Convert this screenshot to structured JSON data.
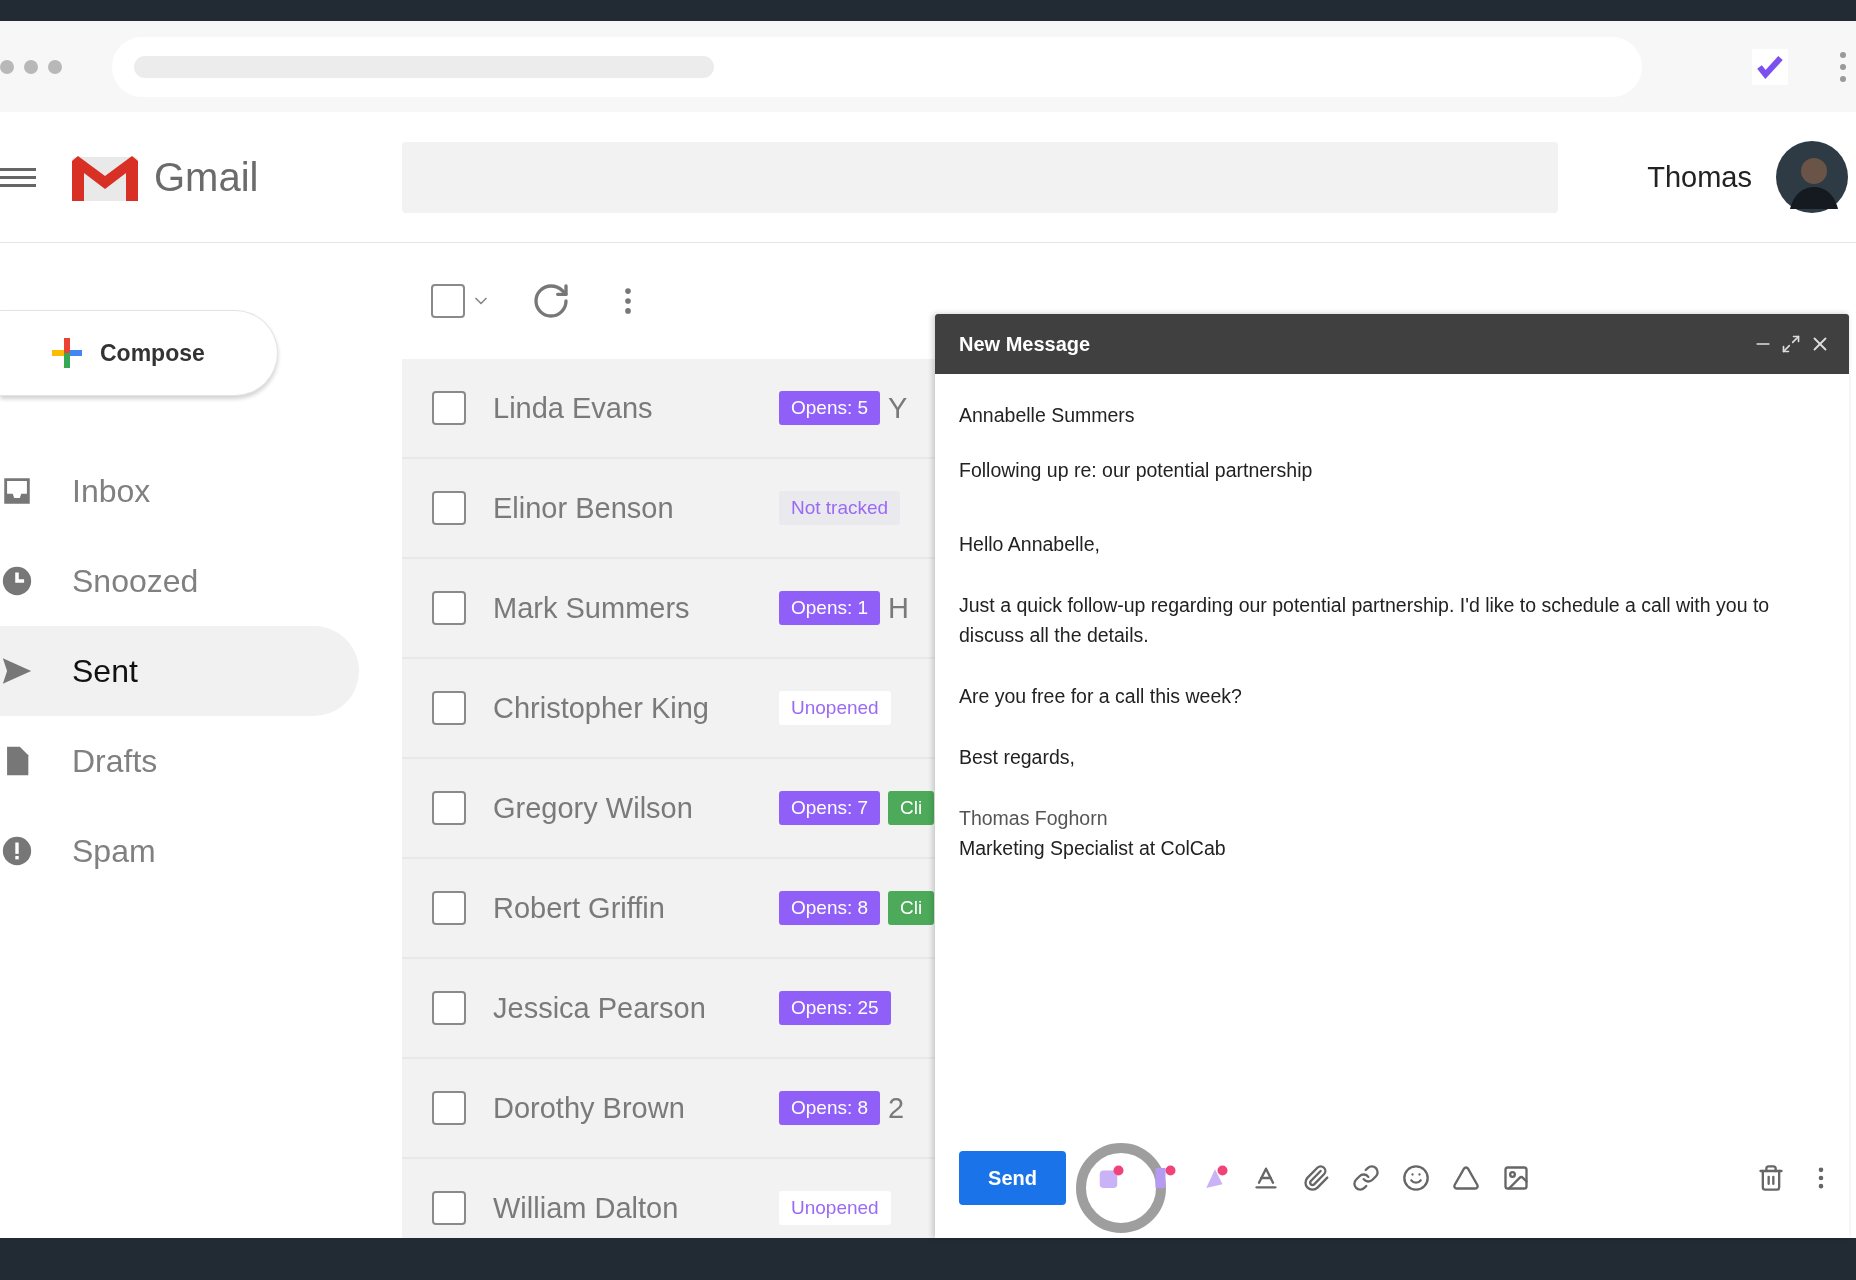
{
  "header": {
    "app_name": "Gmail",
    "user_name": "Thomas"
  },
  "compose_button": {
    "label": "Compose"
  },
  "nav": [
    {
      "label": "Inbox",
      "selected": false
    },
    {
      "label": "Snoozed",
      "selected": false
    },
    {
      "label": "Sent",
      "selected": true
    },
    {
      "label": "Drafts",
      "selected": false
    },
    {
      "label": "Spam",
      "selected": false
    }
  ],
  "toolbar": {
    "select_all_checked": false
  },
  "messages": [
    {
      "sender": "Linda Evans",
      "checked": false,
      "badges": [
        {
          "kind": "opens",
          "text": "Opens: 5"
        }
      ],
      "snippet": "Y"
    },
    {
      "sender": "Elinor Benson",
      "checked": false,
      "badges": [
        {
          "kind": "not_tracked",
          "text": "Not tracked"
        }
      ]
    },
    {
      "sender": "Mark Summers",
      "checked": false,
      "badges": [
        {
          "kind": "opens",
          "text": "Opens: 1"
        }
      ],
      "snippet": "H"
    },
    {
      "sender": "Christopher King",
      "checked": false,
      "badges": [
        {
          "kind": "unopened",
          "text": "Unopened"
        }
      ]
    },
    {
      "sender": "Gregory Wilson",
      "checked": false,
      "badges": [
        {
          "kind": "opens",
          "text": "Opens: 7"
        },
        {
          "kind": "clicks",
          "text": "Cli"
        }
      ]
    },
    {
      "sender": "Robert Griffin",
      "checked": false,
      "badges": [
        {
          "kind": "opens",
          "text": "Opens: 8"
        },
        {
          "kind": "clicks",
          "text": "Cli"
        }
      ]
    },
    {
      "sender": "Jessica Pearson",
      "checked": false,
      "badges": [
        {
          "kind": "opens",
          "text": "Opens: 25"
        }
      ]
    },
    {
      "sender": "Dorothy Brown",
      "checked": false,
      "badges": [
        {
          "kind": "opens",
          "text": "Opens: 8"
        }
      ],
      "snippet": "2"
    },
    {
      "sender": "William Dalton",
      "checked": false,
      "badges": [
        {
          "kind": "unopened",
          "text": "Unopened"
        }
      ]
    }
  ],
  "compose": {
    "title": "New Message",
    "to": "Annabelle Summers",
    "subject": "Following up re: our potential partnership",
    "paragraphs": [
      [
        "Hello Annabelle,"
      ],
      [
        "Just a quick follow-up regarding our potential partnership. I'd like to schedule a call with you to discuss all the details."
      ],
      [
        "Are you free for a call this week?"
      ],
      [
        "Best regards,"
      ],
      [
        "Thomas Foghorn",
        "Marketing Specialist at ColCab"
      ]
    ],
    "send_label": "Send"
  }
}
